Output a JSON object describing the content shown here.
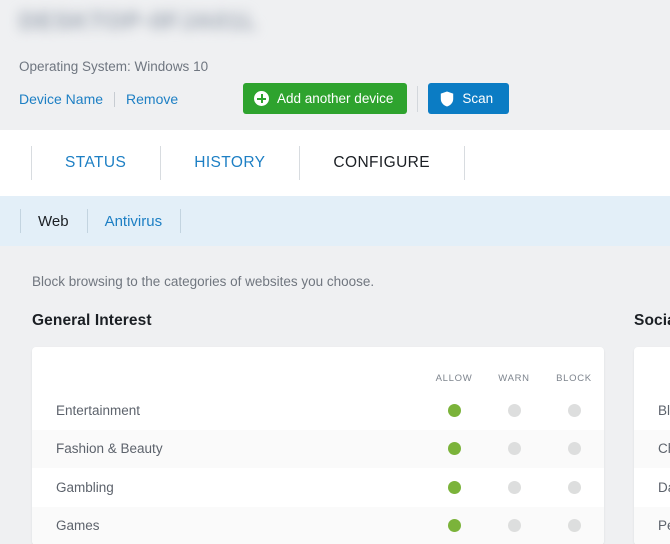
{
  "header": {
    "device_name": "DESKTOP-0FJA01L",
    "os_label": "Operating System: Windows 10",
    "links": [
      {
        "label": "Device Name",
        "name": "device-name-link"
      },
      {
        "label": "Remove",
        "name": "remove-link"
      }
    ],
    "add_device_button": "Add another device",
    "scan_button": "Scan",
    "colors": {
      "add_device": "#2ea32e",
      "scan": "#0b7cc4",
      "link": "#1d7fc4",
      "background": "#eff0f2"
    }
  },
  "tabs": [
    {
      "label": "STATUS",
      "active": false
    },
    {
      "label": "HISTORY",
      "active": false
    },
    {
      "label": "CONFIGURE",
      "active": true
    }
  ],
  "subtabs": [
    {
      "label": "Web",
      "active": true
    },
    {
      "label": "Antivirus",
      "active": false
    }
  ],
  "main": {
    "intro": "Block browsing to the categories of websites you choose.",
    "columns": [
      "ALLOW",
      "WARN",
      "BLOCK"
    ],
    "groups": [
      {
        "title": "General Interest",
        "rows": [
          {
            "label": "Entertainment",
            "selected": "ALLOW"
          },
          {
            "label": "Fashion & Beauty",
            "selected": "ALLOW"
          },
          {
            "label": "Gambling",
            "selected": "ALLOW"
          },
          {
            "label": "Games",
            "selected": "ALLOW"
          }
        ]
      },
      {
        "title": "Social",
        "rows": [
          {
            "label": "Blogs",
            "selected": "ALLOW"
          },
          {
            "label": "Chat",
            "selected": "ALLOW"
          },
          {
            "label": "Dating",
            "selected": "ALLOW"
          },
          {
            "label": "Personals",
            "selected": "ALLOW"
          }
        ]
      }
    ],
    "colors": {
      "selected_dot": "#7bb33a",
      "unselected_dot": "#dddede",
      "card_background": "#ffffff",
      "row_stripe": "#fafafa"
    }
  }
}
